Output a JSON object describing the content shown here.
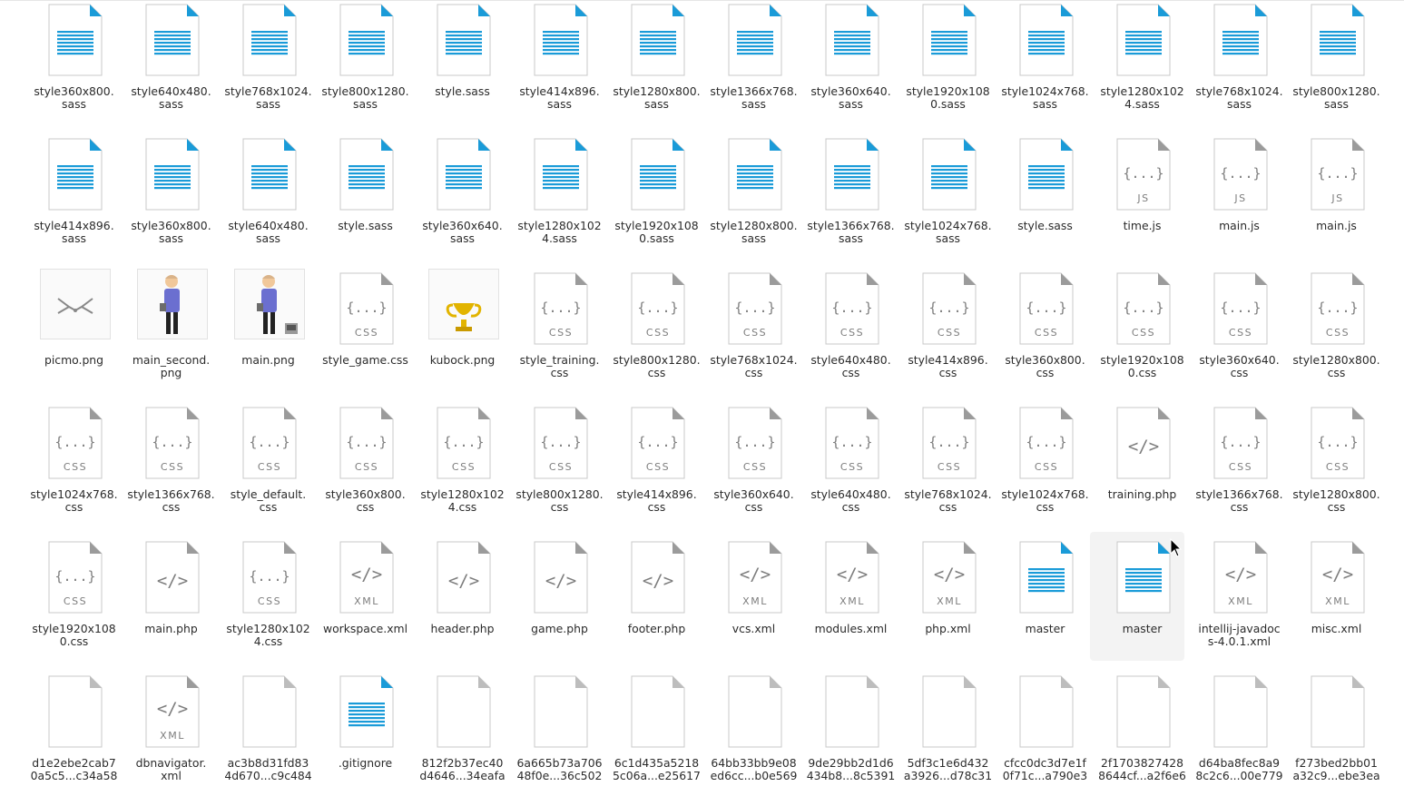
{
  "rows": [
    [
      {
        "name": "style360x800.\nsass",
        "type": "sass"
      },
      {
        "name": "style640x480.\nsass",
        "type": "sass"
      },
      {
        "name": "style768x1024.\nsass",
        "type": "sass"
      },
      {
        "name": "style800x1280.\nsass",
        "type": "sass"
      },
      {
        "name": "style.sass",
        "type": "sass"
      },
      {
        "name": "style414x896.\nsass",
        "type": "sass"
      },
      {
        "name": "style1280x800.\nsass",
        "type": "sass"
      },
      {
        "name": "style1366x768.\nsass",
        "type": "sass"
      },
      {
        "name": "style360x640.\nsass",
        "type": "sass"
      },
      {
        "name": "style1920x108\n0.sass",
        "type": "sass"
      },
      {
        "name": "style1024x768.\nsass",
        "type": "sass"
      },
      {
        "name": "style1280x102\n4.sass",
        "type": "sass"
      },
      {
        "name": "style768x1024.\nsass",
        "type": "sass"
      },
      {
        "name": "style800x1280.\nsass",
        "type": "sass"
      }
    ],
    [
      {
        "name": "style414x896.\nsass",
        "type": "sass"
      },
      {
        "name": "style360x800.\nsass",
        "type": "sass"
      },
      {
        "name": "style640x480.\nsass",
        "type": "sass"
      },
      {
        "name": "style.sass",
        "type": "sass"
      },
      {
        "name": "style360x640.\nsass",
        "type": "sass"
      },
      {
        "name": "style1280x102\n4.sass",
        "type": "sass"
      },
      {
        "name": "style1920x108\n0.sass",
        "type": "sass"
      },
      {
        "name": "style1280x800.\nsass",
        "type": "sass"
      },
      {
        "name": "style1366x768.\nsass",
        "type": "sass"
      },
      {
        "name": "style1024x768.\nsass",
        "type": "sass"
      },
      {
        "name": "style.sass",
        "type": "sass"
      },
      {
        "name": "time.js",
        "type": "js"
      },
      {
        "name": "main.js",
        "type": "js"
      },
      {
        "name": "main.js",
        "type": "js"
      }
    ],
    [
      {
        "name": "picmo.png",
        "type": "picmo"
      },
      {
        "name": "main_second.\npng",
        "type": "person"
      },
      {
        "name": "main.png",
        "type": "person2"
      },
      {
        "name": "style_game.css",
        "type": "css"
      },
      {
        "name": "kubock.png",
        "type": "trophy"
      },
      {
        "name": "style_training.\ncss",
        "type": "css"
      },
      {
        "name": "style800x1280.\ncss",
        "type": "css"
      },
      {
        "name": "style768x1024.\ncss",
        "type": "css"
      },
      {
        "name": "style640x480.\ncss",
        "type": "css"
      },
      {
        "name": "style414x896.\ncss",
        "type": "css"
      },
      {
        "name": "style360x800.\ncss",
        "type": "css"
      },
      {
        "name": "style1920x108\n0.css",
        "type": "css"
      },
      {
        "name": "style360x640.\ncss",
        "type": "css"
      },
      {
        "name": "style1280x800.\ncss",
        "type": "css"
      }
    ],
    [
      {
        "name": "style1024x768.\ncss",
        "type": "css"
      },
      {
        "name": "style1366x768.\ncss",
        "type": "css"
      },
      {
        "name": "style_default.\ncss",
        "type": "css"
      },
      {
        "name": "style360x800.\ncss",
        "type": "css"
      },
      {
        "name": "style1280x102\n4.css",
        "type": "css"
      },
      {
        "name": "style800x1280.\ncss",
        "type": "css"
      },
      {
        "name": "style414x896.\ncss",
        "type": "css"
      },
      {
        "name": "style360x640.\ncss",
        "type": "css"
      },
      {
        "name": "style640x480.\ncss",
        "type": "css"
      },
      {
        "name": "style768x1024.\ncss",
        "type": "css"
      },
      {
        "name": "style1024x768.\ncss",
        "type": "css"
      },
      {
        "name": "training.php",
        "type": "php"
      },
      {
        "name": "style1366x768.\ncss",
        "type": "css"
      },
      {
        "name": "style1280x800.\ncss",
        "type": "css"
      }
    ],
    [
      {
        "name": "style1920x108\n0.css",
        "type": "css"
      },
      {
        "name": "main.php",
        "type": "php"
      },
      {
        "name": "style1280x102\n4.css",
        "type": "css"
      },
      {
        "name": "workspace.xml",
        "type": "xml"
      },
      {
        "name": "header.php",
        "type": "php"
      },
      {
        "name": "game.php",
        "type": "php"
      },
      {
        "name": "footer.php",
        "type": "php"
      },
      {
        "name": "vcs.xml",
        "type": "xml"
      },
      {
        "name": "modules.xml",
        "type": "xml"
      },
      {
        "name": "php.xml",
        "type": "xml"
      },
      {
        "name": "master",
        "type": "sass"
      },
      {
        "name": "master",
        "type": "sass",
        "selected": true
      },
      {
        "name": "intellij-javadoc\ns-4.0.1.xml",
        "type": "xml"
      },
      {
        "name": "misc.xml",
        "type": "xml"
      }
    ],
    [
      {
        "name": "d1e2ebe2cab7\n0a5c5...c34a58",
        "type": "blank"
      },
      {
        "name": "dbnavigator.\nxml",
        "type": "xml"
      },
      {
        "name": "ac3b8d31fd83\n4d670...c9c484",
        "type": "blank"
      },
      {
        "name": ".gitignore",
        "type": "sass"
      },
      {
        "name": "812f2b37ec40\nd4646...34eafa",
        "type": "blank"
      },
      {
        "name": "6a665b73a706\n48f0e...36c502",
        "type": "blank"
      },
      {
        "name": "6c1d435a5218\n5c06a...e25617",
        "type": "blank"
      },
      {
        "name": "64bb33bb9e08\ned6cc...b0e569",
        "type": "blank"
      },
      {
        "name": "9de29bb2d1d6\n434b8...8c5391",
        "type": "blank"
      },
      {
        "name": "5df3c1e6d432\na3926...d78c31",
        "type": "blank"
      },
      {
        "name": "cfcc0dc3d7e1f\n0f71c...a790e3",
        "type": "blank"
      },
      {
        "name": "2f1703827428\n8644cf...a2f6e6",
        "type": "blank"
      },
      {
        "name": "d64ba8fec8a9\n8c2c6...00e779",
        "type": "blank"
      },
      {
        "name": "f273bed2bb01\na32c9...ebe3ea",
        "type": "blank"
      }
    ]
  ],
  "icon_text": {
    "css": "CSS",
    "js": "JS",
    "xml": "XML"
  },
  "colors": {
    "accent": "#1a9bd8",
    "gray": "#7d7d7d",
    "paper_border": "#c8c8c8"
  }
}
